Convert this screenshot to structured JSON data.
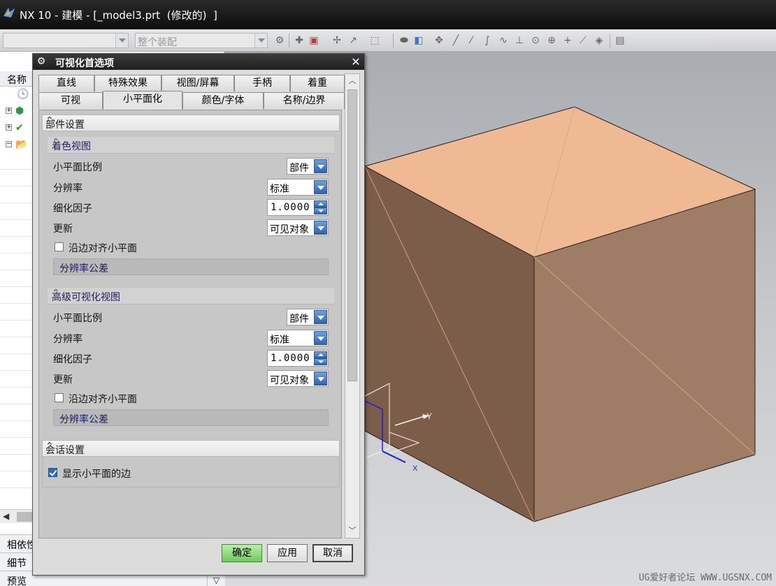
{
  "app": {
    "title": "NX 10 - 建模 - [_model3.prt  (修改的)  ]"
  },
  "toolbar": {
    "filter_combo_value": "",
    "scope_combo_value": "整个装配"
  },
  "navigator": {
    "header": "名称",
    "sections": [
      {
        "label": "相依性"
      },
      {
        "label": "细节"
      },
      {
        "label": "预览"
      }
    ]
  },
  "dialog": {
    "title": "可视化首选项",
    "tabs_row1": [
      "直线",
      "特殊效果",
      "视图/屏幕",
      "手柄",
      "着重"
    ],
    "tabs_row2": [
      "可视",
      "小平面化",
      "颜色/字体",
      "名称/边界"
    ],
    "active_tab": "小平面化",
    "part_settings": {
      "title": "部件设置",
      "shaded_view": {
        "title": "着色视图",
        "facet_scale_label": "小平面比例",
        "facet_scale_value": "部件",
        "resolution_label": "分辨率",
        "resolution_value": "标准",
        "refinement_label": "细化因子",
        "refinement_value": "1.0000",
        "update_label": "更新",
        "update_value": "可见对象",
        "align_edges_label": "沿边对齐小平面",
        "align_edges_checked": false,
        "tolerance_label": "分辨率公差"
      },
      "advanced_view": {
        "title": "高级可视化视图",
        "facet_scale_label": "小平面比例",
        "facet_scale_value": "部件",
        "resolution_label": "分辨率",
        "resolution_value": "标准",
        "refinement_label": "细化因子",
        "refinement_value": "1.0000",
        "update_label": "更新",
        "update_value": "可见对象",
        "align_edges_label": "沿边对齐小平面",
        "align_edges_checked": false,
        "tolerance_label": "分辨率公差"
      }
    },
    "session_settings": {
      "title": "会话设置",
      "show_facet_edges_label": "显示小平面的边",
      "show_facet_edges_checked": true
    },
    "buttons": {
      "ok": "确定",
      "apply": "应用",
      "cancel": "取消"
    }
  },
  "viewport": {
    "axis_y_label": "Y",
    "axis_x_label": "X",
    "watermark": "UG爱好者论坛 WWW.UGSNX.COM",
    "cube_colors": {
      "top": "#eeb993",
      "left": "#7b5d4a",
      "right": "#9e7c66"
    }
  }
}
